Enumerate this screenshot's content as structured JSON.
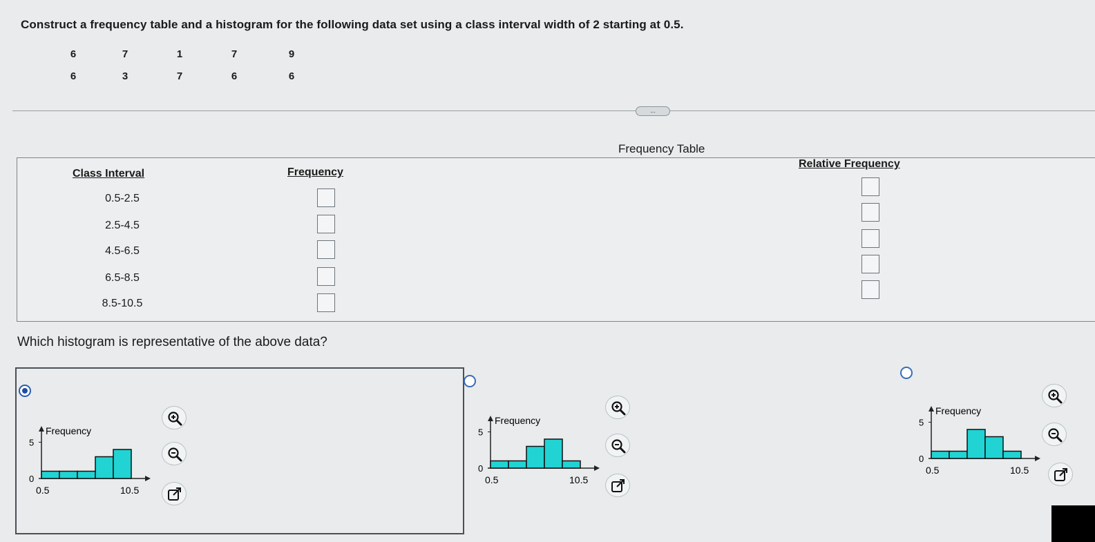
{
  "question": "Construct a frequency table and a histogram for the following data set using a class interval width of 2 starting at 0.5.",
  "data_rows": [
    [
      "6",
      "7",
      "1",
      "7",
      "9"
    ],
    [
      "6",
      "3",
      "7",
      "6",
      "6"
    ]
  ],
  "expander_label": "...",
  "table": {
    "title": "Frequency Table",
    "headers": {
      "class_interval": "Class Interval",
      "frequency": "Frequency",
      "relative_frequency": "Relative Frequency"
    },
    "class_intervals": [
      "0.5-2.5",
      "2.5-4.5",
      "4.5-6.5",
      "6.5-8.5",
      "8.5-10.5"
    ],
    "frequency_values": [
      "",
      "",
      "",
      "",
      ""
    ],
    "relative_frequency_values": [
      "",
      "",
      "",
      "",
      ""
    ]
  },
  "histogram_question": "Which histogram is representative of the above data?",
  "options": [
    {
      "selected": true
    },
    {
      "selected": false
    },
    {
      "selected": false
    }
  ],
  "icons": {
    "zoom_in": "zoom-in-icon",
    "zoom_out": "zoom-out-icon",
    "open": "open-new-window-icon"
  },
  "colors": {
    "bar_fill": "#22d3d3",
    "radio": "#1f4fa0"
  },
  "chart_data": [
    {
      "type": "bar",
      "ylabel": "Frequency",
      "x_ticks": [
        "0.5",
        "10.5"
      ],
      "y_ticks": [
        "0",
        "5"
      ],
      "bins": [
        "0.5-2.5",
        "2.5-4.5",
        "4.5-6.5",
        "6.5-8.5",
        "8.5-10.5"
      ],
      "values": [
        1,
        1,
        1,
        3,
        4
      ],
      "ylim": [
        0,
        5
      ]
    },
    {
      "type": "bar",
      "ylabel": "Frequency",
      "x_ticks": [
        "0.5",
        "10.5"
      ],
      "y_ticks": [
        "0",
        "5"
      ],
      "bins": [
        "0.5-2.5",
        "2.5-4.5",
        "4.5-6.5",
        "6.5-8.5",
        "8.5-10.5"
      ],
      "values": [
        1,
        1,
        3,
        4,
        1
      ],
      "ylim": [
        0,
        5
      ]
    },
    {
      "type": "bar",
      "ylabel": "Frequency",
      "x_ticks": [
        "0.5",
        "10.5"
      ],
      "y_ticks": [
        "0",
        "5"
      ],
      "bins": [
        "0.5-2.5",
        "2.5-4.5",
        "4.5-6.5",
        "6.5-8.5",
        "8.5-10.5"
      ],
      "values": [
        1,
        1,
        4,
        3,
        1
      ],
      "ylim": [
        0,
        5
      ]
    }
  ]
}
